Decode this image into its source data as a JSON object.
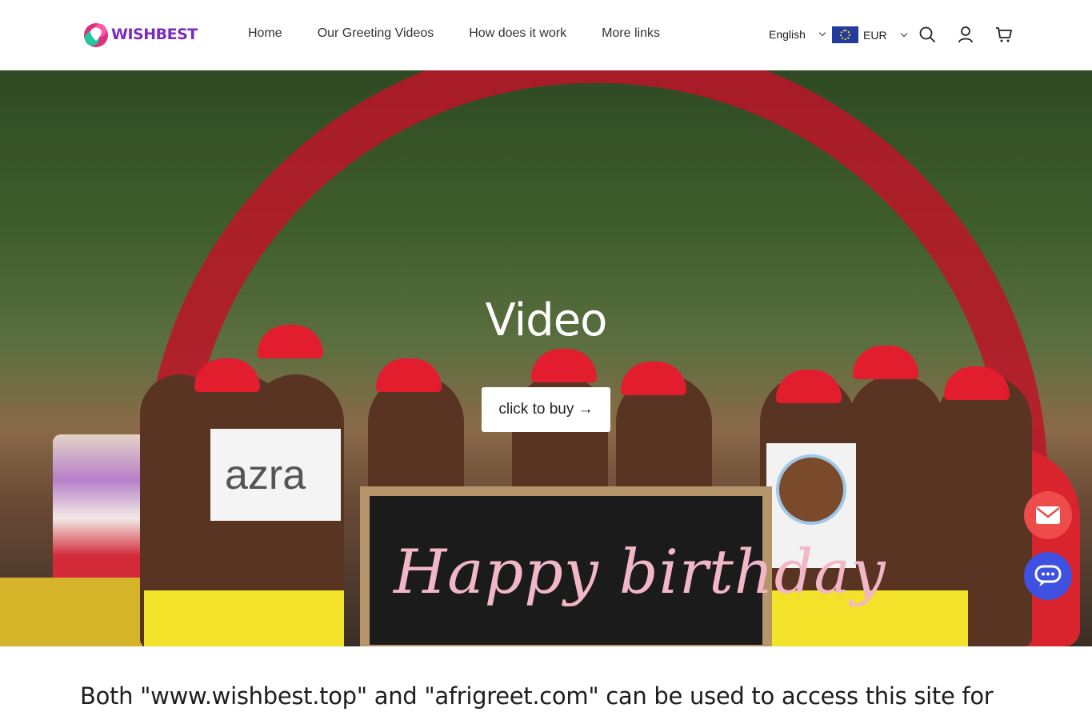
{
  "header": {
    "logo_text": "WISHBEST",
    "nav": [
      {
        "label": "Home"
      },
      {
        "label": "Our Greeting Videos"
      },
      {
        "label": "How does it work"
      },
      {
        "label": "More links"
      }
    ],
    "language": "English",
    "currency": "EUR",
    "icons": [
      "search-icon",
      "account-icon",
      "cart-icon"
    ]
  },
  "hero": {
    "title": "Video",
    "button_label": "click to buy →",
    "paper_name": "azra",
    "chalkboard_text": "Happy birthday"
  },
  "floating": {
    "mail_icon": "mail-icon",
    "chat_icon": "chat-icon",
    "mail_color": "#ee4b4b",
    "chat_color": "#3f51e0"
  },
  "notice": {
    "text": "Both \"www.wishbest.top\" and \"afrigreet.com\" can be used to access this site for"
  },
  "colors": {
    "brand": "#7b2bbd"
  }
}
